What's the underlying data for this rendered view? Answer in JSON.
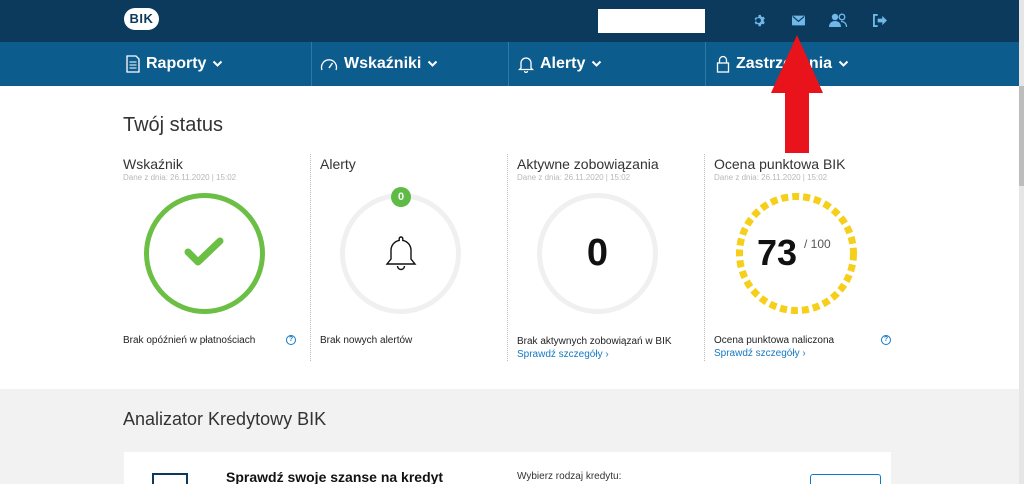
{
  "header": {
    "logo_text": "BIK",
    "icons": [
      "gear-icon",
      "envelope-icon",
      "users-icon",
      "logout-icon"
    ]
  },
  "nav": {
    "items": [
      {
        "label": "Raporty",
        "icon": "document-icon"
      },
      {
        "label": "Wskaźniki",
        "icon": "gauge-icon"
      },
      {
        "label": "Alerty",
        "icon": "bell-icon"
      },
      {
        "label": "Zastrzeżenia",
        "icon": "lock-icon"
      }
    ]
  },
  "status": {
    "title": "Twój status",
    "cards": [
      {
        "title": "Wskaźnik",
        "date": "Dane z dnia: 26.11.2020 | 15:02",
        "caption": "Brak opóźnień w płatnościach"
      },
      {
        "title": "Alerty",
        "badge": "0",
        "caption": "Brak nowych alertów"
      },
      {
        "title": "Aktywne zobowiązania",
        "date": "Dane z dnia: 26.11.2020 | 15:02",
        "value": "0",
        "caption": "Brak aktywnych zobowiązań w BIK",
        "link": "Sprawdź szczegóły ›"
      },
      {
        "title": "Ocena punktowa BIK",
        "date": "Dane z dnia: 26.11.2020 | 15:02",
        "score": "73",
        "score_max": "/ 100",
        "score_fraction": 0.73,
        "caption": "Ocena punktowa naliczona",
        "link": "Sprawdź szczegóły ›"
      }
    ]
  },
  "analyzer": {
    "title": "Analizator Kredytowy BIK",
    "heading": "Sprawdź swoje szanse na kredyt",
    "select_label": "Wybierz rodzaj kredytu:"
  },
  "colors": {
    "topbar": "#0b3a5c",
    "navbar": "#0d5c8e",
    "success": "#6cbf45",
    "score": "#f5cf1a",
    "link": "#1479c4",
    "annotation_arrow": "#e8131b"
  }
}
